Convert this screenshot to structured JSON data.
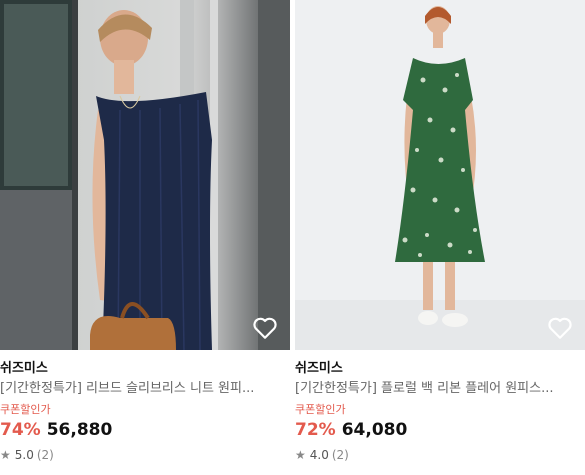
{
  "products": [
    {
      "brand": "쉬즈미스",
      "name": "[기간한정특가] 리브드 슬리브리스 니트 원피...",
      "coupon": "쿠폰할인가",
      "discount": "74%",
      "price": "56,880",
      "rating": "5.0",
      "review_count": "(2)",
      "image_desc": "navy ribbed sleeveless knit dress",
      "colors": {
        "dress": "#1e2a48",
        "bag": "#b0703a"
      }
    },
    {
      "brand": "쉬즈미스",
      "name": "[기간한정특가] 플로럴 백 리본 플레어 원피스...",
      "coupon": "쿠폰할인가",
      "discount": "72%",
      "price": "64,080",
      "rating": "4.0",
      "review_count": "(2)",
      "image_desc": "green floral flare dress",
      "colors": {
        "dress": "#2f6a3e",
        "pattern": "#e8efe0"
      }
    }
  ],
  "icons": {
    "wishlist": "heart-outline-icon",
    "star": "star-icon"
  },
  "accent_color": "#e35a4d"
}
